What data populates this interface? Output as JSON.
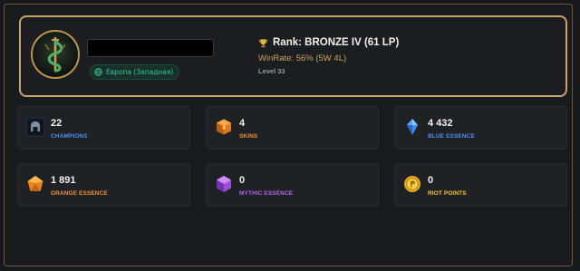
{
  "profile": {
    "region": "Европа (Западная)",
    "rank_text": "Rank: BRONZE IV (61 LP)",
    "winrate_text": "WinRate: 56% (5W 4L)",
    "level_text": "Level 33"
  },
  "stats": [
    {
      "value": "22",
      "label": "CHAMPIONS",
      "color": "#4d8ef0",
      "icon": "helmet-icon"
    },
    {
      "value": "4",
      "label": "SKINS",
      "color": "#f09236",
      "icon": "orange-chest-icon"
    },
    {
      "value": "4 432",
      "label": "BLUE ESSENCE",
      "color": "#4d8ef0",
      "icon": "blue-crystal-icon"
    },
    {
      "value": "1 891",
      "label": "ORANGE ESSENCE",
      "color": "#f09236",
      "icon": "orange-gem-icon"
    },
    {
      "value": "0",
      "label": "MYTHIC ESSENCE",
      "color": "#b066e8",
      "icon": "purple-gem-icon"
    },
    {
      "value": "0",
      "label": "RIOT POINTS",
      "color": "#f2c230",
      "icon": "coin-icon"
    }
  ],
  "colors": {
    "accent_gold": "#c8a46a",
    "region_green": "#3fc59a"
  }
}
